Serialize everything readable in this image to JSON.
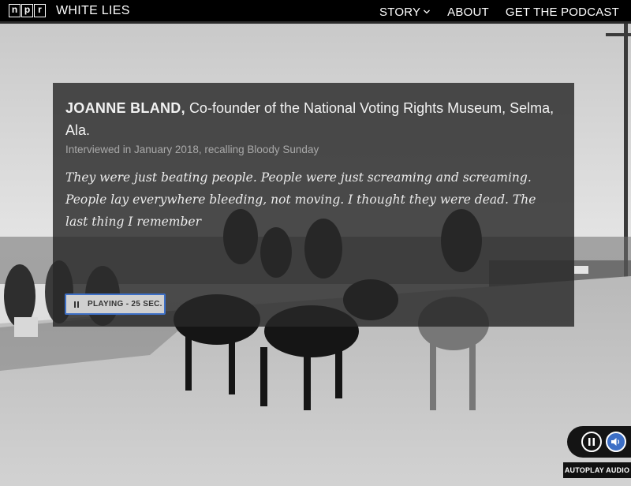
{
  "header": {
    "logo_letters": [
      "n",
      "p",
      "r"
    ],
    "show_title": "WHITE LIES",
    "nav": [
      {
        "label": "STORY",
        "has_dropdown": true
      },
      {
        "label": "ABOUT"
      },
      {
        "label": "GET THE PODCAST"
      }
    ]
  },
  "card": {
    "speaker_name": "JOANNE BLAND,",
    "speaker_title": "Co-founder of the National Voting Rights Museum, Selma, Ala.",
    "interview_note": "Interviewed in January 2018, recalling Bloody Sunday",
    "quote": "They were just beating people. People were just screaming and screaming. People lay everywhere bleeding, not moving. I thought they were dead. The last thing I remember",
    "play_button_label": "PLAYING - 25 SEC."
  },
  "audio_control": {
    "autoplay_label": "AUTOPLAY AUDIO"
  },
  "colors": {
    "accent": "#3d6fc6",
    "header_bg": "#000000",
    "card_bg": "#282828"
  },
  "icons": [
    "npr-logo",
    "chevron-down-icon",
    "pause-icon",
    "speaker-icon"
  ]
}
